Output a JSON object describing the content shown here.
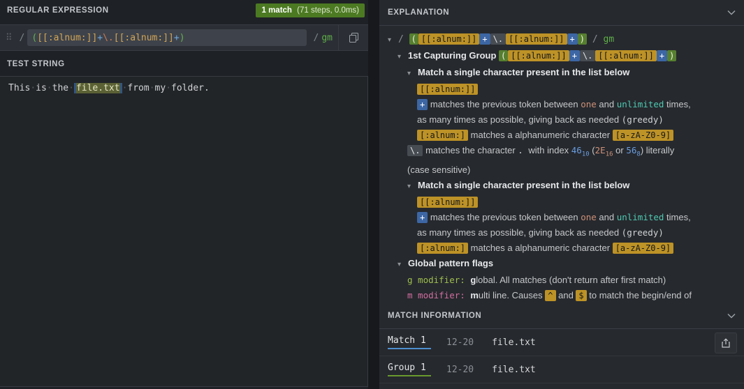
{
  "left": {
    "title": "REGULAR EXPRESSION",
    "badge": {
      "text": "1 match",
      "detail": "(71 steps, 0.0ms)"
    },
    "regex": {
      "delimiter": "/",
      "raw_pattern": "([[:alnum:]]+\\.[[:alnum:]]+)",
      "flags": "gm",
      "pattern_parts": [
        {
          "t": "paren",
          "s": "("
        },
        {
          "t": "cc",
          "s": "[[:alnum:]]"
        },
        {
          "t": "plus",
          "s": "+"
        },
        {
          "t": "esc",
          "s": "\\."
        },
        {
          "t": "cc",
          "s": "[[:alnum:]]"
        },
        {
          "t": "plus",
          "s": "+"
        },
        {
          "t": "paren",
          "s": ")"
        }
      ],
      "copy_icon": "copy-icon",
      "drag_icon": "⠿"
    },
    "test_title": "TEST STRING",
    "test_string": {
      "raw": "This is the file.txt from my folder.",
      "segments": [
        {
          "t": "w",
          "s": "This"
        },
        {
          "t": "sep",
          "s": "·"
        },
        {
          "t": "w",
          "s": "is"
        },
        {
          "t": "sep",
          "s": "·"
        },
        {
          "t": "w",
          "s": "the"
        },
        {
          "t": "sep",
          "s": "·"
        },
        {
          "t": "m",
          "s": "file.txt"
        },
        {
          "t": "sep",
          "s": "·"
        },
        {
          "t": "w",
          "s": "from"
        },
        {
          "t": "sep",
          "s": "·"
        },
        {
          "t": "w",
          "s": "my"
        },
        {
          "t": "sep",
          "s": "·"
        },
        {
          "t": "w",
          "s": "folder."
        }
      ]
    }
  },
  "explanation": {
    "title": "EXPLANATION",
    "lines": [
      {
        "indent": 0,
        "chevron": true,
        "segments": [
          {
            "t": "delim",
            "s": "/ "
          },
          {
            "t": "paren",
            "s": "("
          },
          {
            "t": "cc",
            "s": "[[:alnum:]]"
          },
          {
            "t": "plus",
            "s": "+"
          },
          {
            "t": "esc",
            "s": "\\."
          },
          {
            "t": "cc",
            "s": "[[:alnum:]]"
          },
          {
            "t": "plus",
            "s": "+"
          },
          {
            "t": "paren",
            "s": ")"
          },
          {
            "t": "delim",
            "s": " / "
          },
          {
            "t": "flags",
            "s": "gm"
          }
        ]
      },
      {
        "indent": 1,
        "chevron": true,
        "segments": [
          {
            "t": "b",
            "s": "1st Capturing Group "
          },
          {
            "t": "paren",
            "s": "("
          },
          {
            "t": "cc",
            "s": "[[:alnum:]]"
          },
          {
            "t": "plus",
            "s": "+"
          },
          {
            "t": "esc",
            "s": "\\."
          },
          {
            "t": "cc",
            "s": "[[:alnum:]]"
          },
          {
            "t": "plus",
            "s": "+"
          },
          {
            "t": "paren",
            "s": ")"
          }
        ]
      },
      {
        "indent": 2,
        "chevron": true,
        "segments": [
          {
            "t": "b",
            "s": "Match a single character present in the list below"
          }
        ]
      },
      {
        "indent": 3,
        "chevron": false,
        "segments": [
          {
            "t": "cc",
            "s": "[[:alnum:]]"
          }
        ]
      },
      {
        "indent": 3,
        "chevron": false,
        "segments": [
          {
            "t": "plus",
            "s": "+"
          },
          {
            "t": "text",
            "s": " matches the previous token between "
          },
          {
            "t": "orange",
            "s": "one"
          },
          {
            "t": "text",
            "s": " and "
          },
          {
            "t": "teal",
            "s": "unlimited"
          },
          {
            "t": "text",
            "s": " times,"
          }
        ]
      },
      {
        "indent": 3,
        "chevron": false,
        "segments": [
          {
            "t": "text",
            "s": "as many times as possible, giving back as needed "
          },
          {
            "t": "mono",
            "s": "(greedy)"
          }
        ]
      },
      {
        "indent": 3,
        "chevron": false,
        "segments": [
          {
            "t": "cc",
            "s": "[:alnum:]"
          },
          {
            "t": "text",
            "s": " matches a alphanumeric character "
          },
          {
            "t": "cc",
            "s": "[a-zA-Z0-9]"
          }
        ]
      },
      {
        "indent": 2,
        "chevron": false,
        "segments": [
          {
            "t": "esc",
            "s": "\\."
          },
          {
            "t": "text",
            "s": " matches the character "
          },
          {
            "t": "mono",
            "s": ". "
          },
          {
            "t": "text",
            "s": "with index "
          },
          {
            "t": "blue",
            "s": "46",
            "sub": "10"
          },
          {
            "t": "text",
            "s": " ("
          },
          {
            "t": "orange",
            "s": "2E",
            "sub": "16"
          },
          {
            "t": "text",
            "s": " or "
          },
          {
            "t": "blue",
            "s": "56",
            "sub": "8"
          },
          {
            "t": "text",
            "s": ") literally"
          }
        ]
      },
      {
        "indent": 2,
        "chevron": false,
        "segments": [
          {
            "t": "text",
            "s": "(case sensitive)"
          }
        ]
      },
      {
        "indent": 2,
        "chevron": true,
        "segments": [
          {
            "t": "b",
            "s": "Match a single character present in the list below"
          }
        ]
      },
      {
        "indent": 3,
        "chevron": false,
        "segments": [
          {
            "t": "cc",
            "s": "[[:alnum:]]"
          }
        ]
      },
      {
        "indent": 3,
        "chevron": false,
        "segments": [
          {
            "t": "plus",
            "s": "+"
          },
          {
            "t": "text",
            "s": " matches the previous token between "
          },
          {
            "t": "orange",
            "s": "one"
          },
          {
            "t": "text",
            "s": " and "
          },
          {
            "t": "teal",
            "s": "unlimited"
          },
          {
            "t": "text",
            "s": " times,"
          }
        ]
      },
      {
        "indent": 3,
        "chevron": false,
        "segments": [
          {
            "t": "text",
            "s": "as many times as possible, giving back as needed "
          },
          {
            "t": "mono",
            "s": "(greedy)"
          }
        ]
      },
      {
        "indent": 3,
        "chevron": false,
        "segments": [
          {
            "t": "cc",
            "s": "[:alnum:]"
          },
          {
            "t": "text",
            "s": " matches a alphanumeric character "
          },
          {
            "t": "cc",
            "s": "[a-zA-Z0-9]"
          }
        ]
      },
      {
        "indent": 1,
        "chevron": true,
        "segments": [
          {
            "t": "b",
            "s": "Global pattern flags"
          }
        ]
      },
      {
        "indent": 2,
        "chevron": false,
        "segments": [
          {
            "t": "gflag",
            "s": "g modifier: "
          },
          {
            "t": "b",
            "s": "g"
          },
          {
            "t": "text",
            "s": "lobal. All matches (don't return after first match)"
          }
        ]
      },
      {
        "indent": 2,
        "chevron": false,
        "segments": [
          {
            "t": "mflag",
            "s": "m modifier: "
          },
          {
            "t": "b",
            "s": "m"
          },
          {
            "t": "text",
            "s": "ulti line. Causes "
          },
          {
            "t": "cc",
            "s": "^"
          },
          {
            "t": "text",
            "s": " and "
          },
          {
            "t": "cc",
            "s": "$"
          },
          {
            "t": "text",
            "s": " to match the begin/end of"
          }
        ]
      }
    ]
  },
  "match_info": {
    "title": "MATCH INFORMATION",
    "rows": [
      {
        "label": "Match 1",
        "range": "12-20",
        "value": "file.txt",
        "underline": "#4f8fd0"
      },
      {
        "label": "Group 1",
        "range": "12-20",
        "value": "file.txt",
        "underline": "#6a9a2e"
      }
    ]
  },
  "colors": {
    "badge_green": "#4c7a22",
    "token_charclass": "#bd9226",
    "token_quantifier": "#3c66a4",
    "token_group": "#567f2f",
    "match_underline": "#4f8fd0",
    "group_underline": "#6a9a2e"
  }
}
